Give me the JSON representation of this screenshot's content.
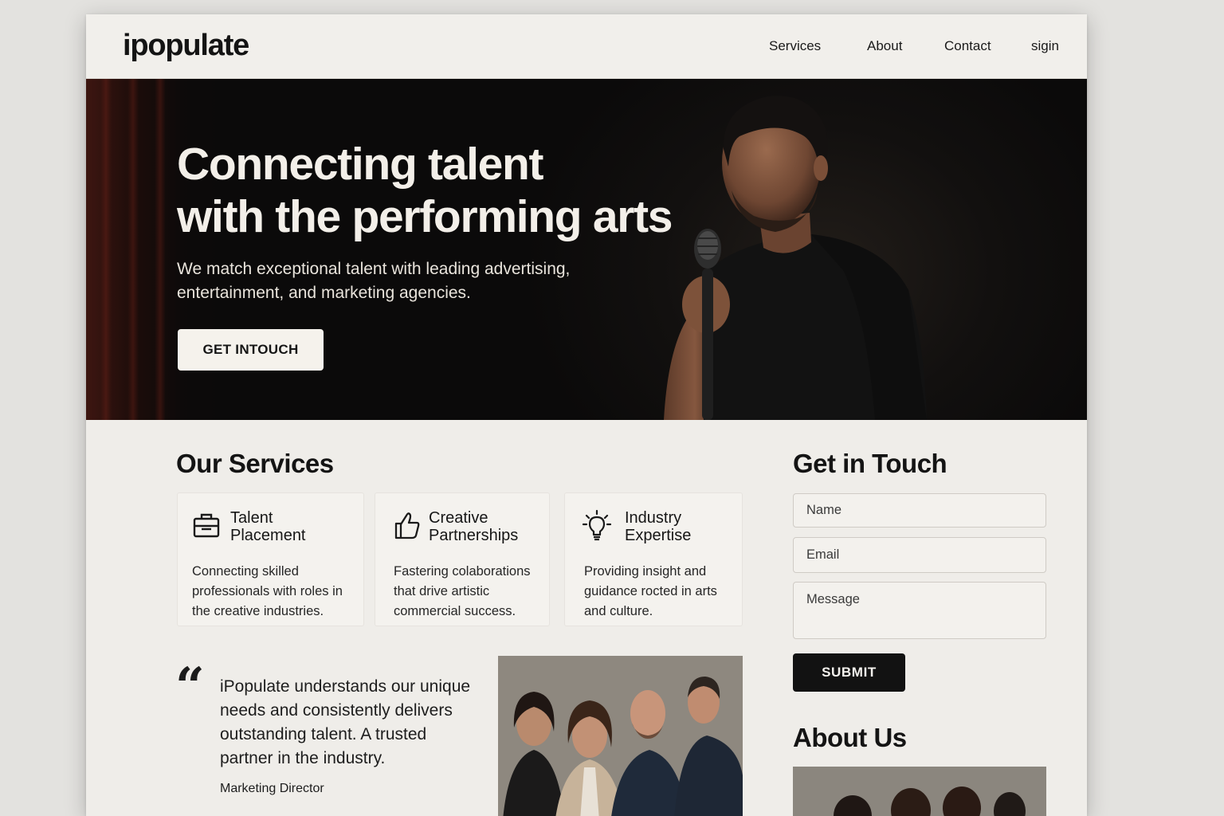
{
  "brand": {
    "logo": "ipopulate"
  },
  "nav": {
    "items": [
      {
        "label": "Services"
      },
      {
        "label": "About"
      },
      {
        "label": "Contact"
      },
      {
        "label": "sigin"
      }
    ]
  },
  "hero": {
    "title_line1": "Connecting talent",
    "title_line2": "with the performing arts",
    "subtitle": "We match exceptional talent with leading advertising, entertainment, and marketing agencies.",
    "cta_label": "GET INTOUCH"
  },
  "services": {
    "heading": "Our Services",
    "cards": [
      {
        "icon": "briefcase-icon",
        "title_line1": "Talent",
        "title_line2": "Placement",
        "description": "Connecting skilled professionals with roles in the creative industries."
      },
      {
        "icon": "thumbs-up-icon",
        "title_line1": "Creative",
        "title_line2": "Partnerships",
        "description": "Fastering colaborations that drive artistic commercial success."
      },
      {
        "icon": "lightbulb-icon",
        "title_line1": "Industry",
        "title_line2": "Expertise",
        "description": "Providing insight and guidance rocted in arts and culture."
      }
    ]
  },
  "testimonial": {
    "quote_mark": "“",
    "text": "iPopulate understands our unique needs and consistently delivers outstanding talent. A trusted partner in the industry.",
    "author": "Marketing Director"
  },
  "contact": {
    "heading": "Get in Touch",
    "name_placeholder": "Name",
    "email_placeholder": "Email",
    "message_placeholder": "Message",
    "submit_label": "SUBMIT"
  },
  "about": {
    "heading": "About Us"
  },
  "colors": {
    "page_background": "#efede9",
    "hero_background": "#0b0a0a",
    "button_dark": "#121212",
    "text_primary": "#161616"
  }
}
